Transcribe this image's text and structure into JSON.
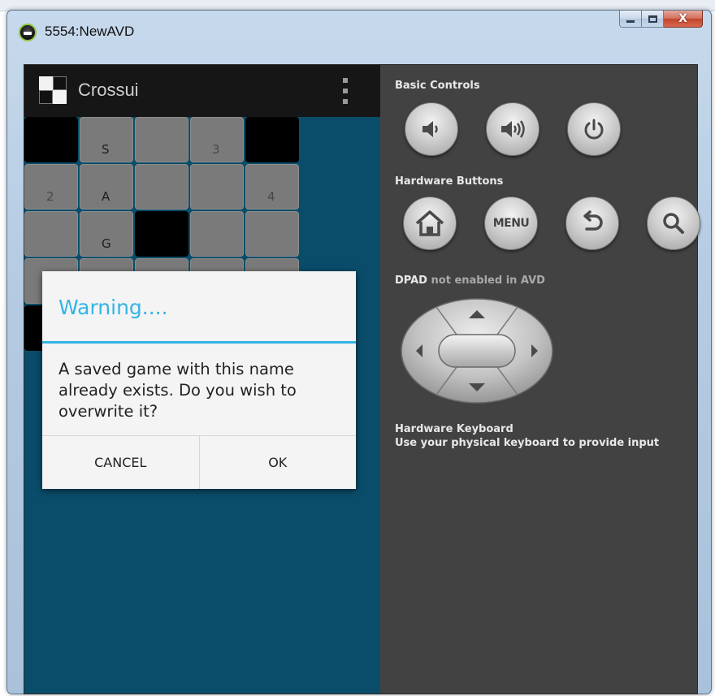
{
  "window": {
    "title": "5554:NewAVD",
    "close_glyph": "X"
  },
  "app": {
    "title": "Crossui"
  },
  "grid": {
    "rows": [
      [
        {
          "black": true
        },
        {
          "letter": "S"
        },
        {},
        {
          "num": "3"
        },
        {
          "black": true
        }
      ],
      [
        {
          "num": "2"
        },
        {
          "letter": "A"
        },
        {},
        {},
        {
          "num": "4"
        }
      ],
      [
        {},
        {
          "letter": "G"
        },
        {
          "black": true
        },
        {},
        {}
      ],
      [
        {},
        {},
        {},
        {},
        {}
      ],
      [
        {
          "black": true
        },
        {},
        {},
        {},
        {}
      ]
    ]
  },
  "dialog": {
    "title": "Warning....",
    "message": "A saved game with this name already exists. Do you wish to overwrite it?",
    "cancel_label": "CANCEL",
    "ok_label": "OK"
  },
  "controls": {
    "basic_label": "Basic Controls",
    "hardware_label": "Hardware Buttons",
    "dpad_label": "DPAD",
    "dpad_status": "not enabled in AVD",
    "menu_label": "MENU",
    "keyboard_title": "Hardware Keyboard",
    "keyboard_desc": "Use your physical keyboard to provide input"
  },
  "icons": {
    "basic": [
      "volume-down-icon",
      "volume-up-icon",
      "power-icon"
    ],
    "hardware": [
      "home-icon",
      "menu-button",
      "back-icon",
      "search-icon"
    ]
  },
  "colors": {
    "accent": "#33b5e5",
    "device_bg": "#0a4d6a",
    "panel_bg": "#424242",
    "cell": "#7a7a7a"
  }
}
